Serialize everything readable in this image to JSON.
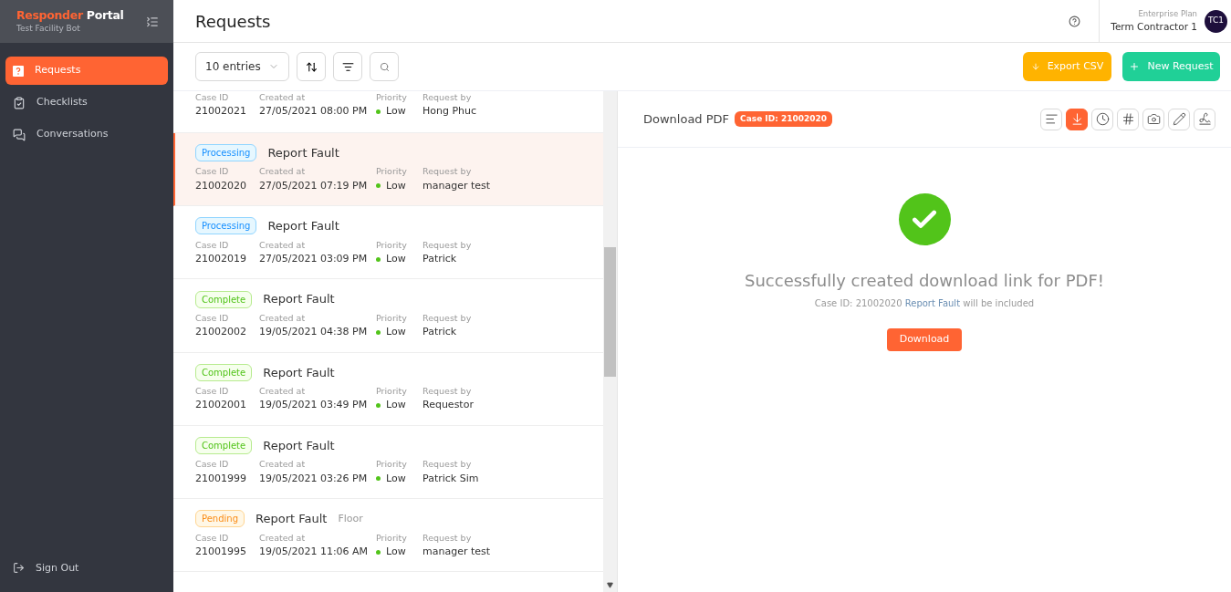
{
  "sidebar": {
    "brand": {
      "first": "Responder",
      "second": "Portal"
    },
    "subtitle": "Test Facility Bot",
    "items": [
      {
        "label": "Requests",
        "kind": "requests",
        "selected": true
      },
      {
        "label": "Checklists",
        "kind": "checklists",
        "selected": false
      },
      {
        "label": "Conversations",
        "kind": "conversations",
        "selected": false
      }
    ],
    "sign_out": "Sign Out"
  },
  "header": {
    "title": "Requests",
    "plan": "Enterprise Plan",
    "user": "Term Contractor 1",
    "avatar": "TC1"
  },
  "toolbar": {
    "entries": "10 entries",
    "export": "Export CSV",
    "new_request": "New Request"
  },
  "list": {
    "rows": [
      {
        "selected": false,
        "case_label": "Case ID",
        "case_id": "21002021",
        "created_label": "Created at",
        "created": "27/05/2021 08:00 PM",
        "priority_label": "Priority",
        "priority": "Low",
        "by_label": "Request by",
        "by": "Hong Phuc"
      },
      {
        "selected": true,
        "status": "Processing",
        "kind": "processing",
        "title": "Report Fault",
        "case_label": "Case ID",
        "case_id": "21002020",
        "created_label": "Created at",
        "created": "27/05/2021 07:19 PM",
        "priority_label": "Priority",
        "priority": "Low",
        "by_label": "Request by",
        "by": "manager test"
      },
      {
        "selected": false,
        "status": "Processing",
        "kind": "processing",
        "title": "Report Fault",
        "case_label": "Case ID",
        "case_id": "21002019",
        "created_label": "Created at",
        "created": "27/05/2021 03:09 PM",
        "priority_label": "Priority",
        "priority": "Low",
        "by_label": "Request by",
        "by": "Patrick"
      },
      {
        "selected": false,
        "status": "Complete",
        "kind": "complete",
        "title": "Report Fault",
        "case_label": "Case ID",
        "case_id": "21002002",
        "created_label": "Created at",
        "created": "19/05/2021 04:38 PM",
        "priority_label": "Priority",
        "priority": "Low",
        "by_label": "Request by",
        "by": "Patrick"
      },
      {
        "selected": false,
        "status": "Complete",
        "kind": "complete",
        "title": "Report Fault",
        "case_label": "Case ID",
        "case_id": "21002001",
        "created_label": "Created at",
        "created": "19/05/2021 03:49 PM",
        "priority_label": "Priority",
        "priority": "Low",
        "by_label": "Request by",
        "by": "Requestor"
      },
      {
        "selected": false,
        "status": "Complete",
        "kind": "complete",
        "title": "Report Fault",
        "case_label": "Case ID",
        "case_id": "21001999",
        "created_label": "Created at",
        "created": "19/05/2021 03:26 PM",
        "priority_label": "Priority",
        "priority": "Low",
        "by_label": "Request by",
        "by": "Patrick Sim"
      },
      {
        "selected": false,
        "status": "Pending",
        "kind": "pending",
        "title": "Report Fault",
        "location": "Floor",
        "case_label": "Case ID",
        "case_id": "21001995",
        "created_label": "Created at",
        "created": "19/05/2021 11:06 AM",
        "priority_label": "Priority",
        "priority": "Low",
        "by_label": "Request by",
        "by": "manager test"
      }
    ]
  },
  "detail": {
    "title": "Download PDF",
    "case_badge": "Case ID: 21002020",
    "tools": [
      {
        "kind": "notes",
        "selected": false
      },
      {
        "kind": "download",
        "selected": true
      },
      {
        "kind": "history",
        "selected": false
      },
      {
        "kind": "number",
        "selected": false
      },
      {
        "kind": "photo",
        "selected": false
      },
      {
        "kind": "edit",
        "selected": false
      },
      {
        "kind": "signature",
        "selected": false
      }
    ],
    "success_title": "Successfully created download link for PDF!",
    "note_prefix": "Case ID: 21002020",
    "note_link": "Report Fault",
    "note_suffix": "will be included",
    "download": "Download"
  }
}
